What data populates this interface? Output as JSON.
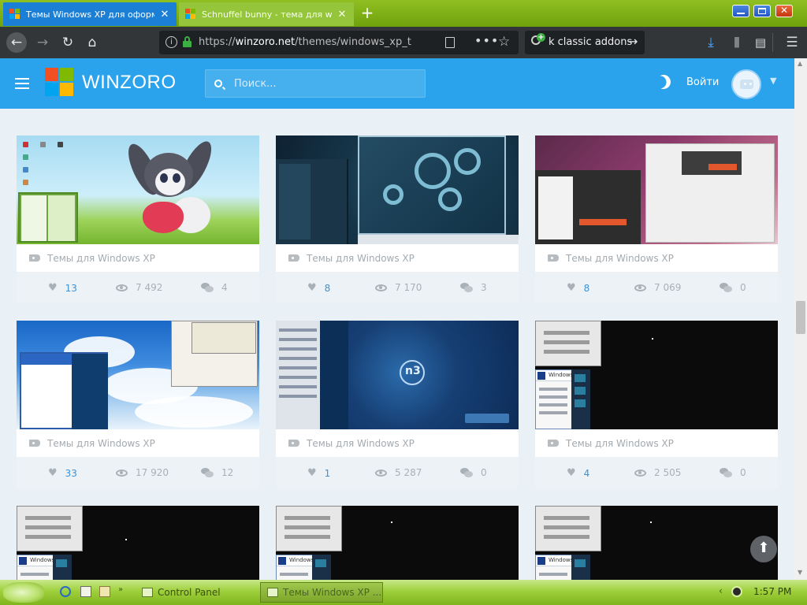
{
  "browser": {
    "tabs": [
      {
        "title": "Темы Windows XP для оформления",
        "active": true
      },
      {
        "title": "Schnuffel bunny - тема для windows",
        "active": false
      }
    ],
    "url": {
      "prefix": "https://",
      "domain": "winzoro.net",
      "path": "/themes/windows_xp_theme"
    },
    "addon_search_value": "k classic addons",
    "icons": {
      "back": "back-arrow-icon",
      "forward": "forward-arrow-icon",
      "reload": "reload-icon",
      "home": "home-icon",
      "info": "info-icon",
      "lock": "lock-icon",
      "reader": "reader-view-icon",
      "more": "more-icon",
      "bookmark": "star-icon",
      "download": "download-icon",
      "library": "library-icon",
      "sidebar": "sidebar-icon",
      "menu": "hamburger-icon"
    }
  },
  "site": {
    "logo_name": "WINZORO",
    "search_placeholder": "Поиск...",
    "login_label": "Войти",
    "logo_colors": [
      "#f25022",
      "#7fba00",
      "#00a4ef",
      "#ffb900"
    ],
    "header_color": "#2aa3ec"
  },
  "cards": [
    {
      "category": "Темы для Windows XP",
      "likes": "13",
      "views": "7 492",
      "comments": "4",
      "thumb": "bunny"
    },
    {
      "category": "Темы для Windows XP",
      "likes": "8",
      "views": "7 170",
      "comments": "3",
      "thumb": "blue-symbols"
    },
    {
      "category": "Темы для Windows XP",
      "likes": "8",
      "views": "7 069",
      "comments": "0",
      "thumb": "pink-desktop"
    },
    {
      "category": "Темы для Windows XP",
      "likes": "33",
      "views": "17 920",
      "comments": "12",
      "thumb": "sky"
    },
    {
      "category": "Темы для Windows XP",
      "likes": "1",
      "views": "5 287",
      "comments": "0",
      "thumb": "navy"
    },
    {
      "category": "Темы для Windows XP",
      "likes": "4",
      "views": "2 505",
      "comments": "0",
      "thumb": "dark"
    }
  ],
  "partial_cards": [
    {
      "thumb": "dark",
      "menu_title": "Windows XP"
    },
    {
      "thumb": "dark",
      "menu_title": "Windows XP"
    },
    {
      "thumb": "dark",
      "menu_title": "Windows XP"
    }
  ],
  "thumb_text": {
    "row2_menu_title": "Windows XP",
    "navy_brand": "n3"
  },
  "taskbar": {
    "tasks": [
      {
        "label": "Control Panel",
        "active": false
      },
      {
        "label": "Темы Windows XP ...",
        "active": true
      }
    ],
    "clock": "1:57 PM"
  }
}
